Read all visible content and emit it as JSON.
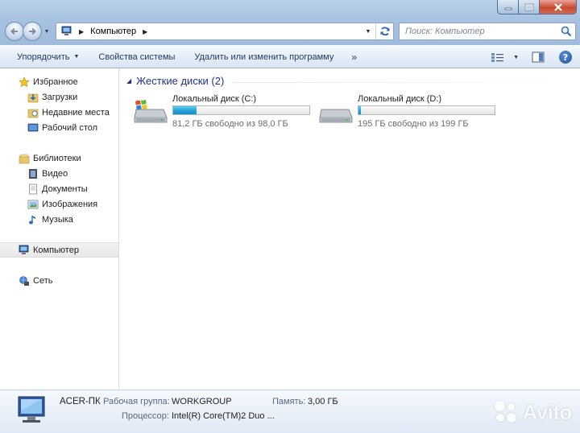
{
  "window": {
    "caption_buttons": [
      "minimize-icon",
      "maximize-icon",
      "close-icon"
    ]
  },
  "address_bar": {
    "path": "Компьютер",
    "icon": "computer-icon"
  },
  "search": {
    "placeholder": "Поиск: Компьютер"
  },
  "command_bar": {
    "organize": "Упорядочить",
    "system_properties": "Свойства системы",
    "uninstall": "Удалить или изменить программу",
    "more": "»"
  },
  "nav": {
    "favorites": "Избранное",
    "downloads": "Загрузки",
    "recent": "Недавние места",
    "desktop": "Рабочий стол",
    "libraries": "Библиотеки",
    "video": "Видео",
    "documents": "Документы",
    "pictures": "Изображения",
    "music": "Музыка",
    "computer": "Компьютер",
    "network": "Сеть"
  },
  "content": {
    "group_title": "Жесткие диски (2)",
    "drives": [
      {
        "name": "Локальный диск (C:)",
        "free_text": "81,2 ГБ свободно из 98,0 ГБ",
        "used_fraction": 0.17,
        "system": true
      },
      {
        "name": "Локальный диск (D:)",
        "free_text": "195 ГБ свободно из 199 ГБ",
        "used_fraction": 0.02,
        "system": false
      }
    ]
  },
  "details": {
    "computer_name": "ACER-ПК",
    "workgroup_label": "Рабочая группа:",
    "workgroup_value": "WORKGROUP",
    "memory_label": "Память:",
    "memory_value": "3,00 ГБ",
    "cpu_label": "Процессор:",
    "cpu_value": "Intel(R) Core(TM)2 Duo ..."
  },
  "colors": {
    "accent": "#1e3287",
    "drive_fill": "#2aa4d8",
    "glass": "#a7c2e0"
  },
  "watermark": {
    "text": "Avito"
  }
}
